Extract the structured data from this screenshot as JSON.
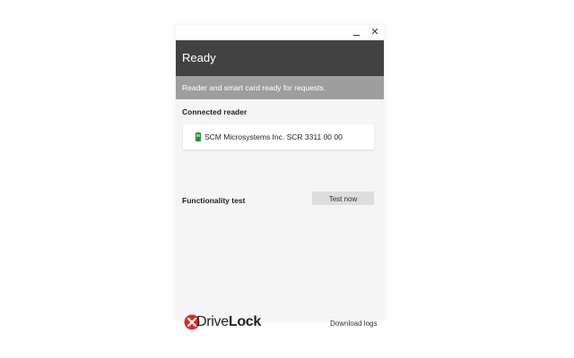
{
  "window": {
    "minimize_icon": "minimize-icon",
    "close_icon": "close-icon",
    "close_glyph": "✕"
  },
  "status": {
    "title": "Ready",
    "message": "Reader and smart card ready for requests.",
    "header_color": "#424242",
    "subheader_color": "#9e9e9e"
  },
  "reader_section": {
    "heading": "Connected reader",
    "reader_name": "SCM Microsystems Inc. SCR 3311 00 00",
    "icon": "smart-card-icon",
    "icon_color": "#2e8b3a"
  },
  "test_section": {
    "heading": "Functionality test",
    "button_label": "Test now"
  },
  "footer": {
    "logo_icon": "drivelock-x-icon",
    "logo_part1": "Drive",
    "logo_part2": "Lock",
    "logo_accent": "#d32f2f",
    "download_label": "Download logs"
  }
}
